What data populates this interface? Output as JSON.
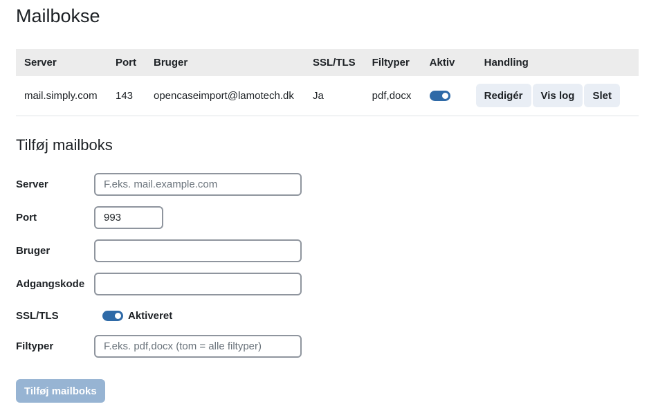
{
  "page": {
    "title": "Mailbokse"
  },
  "table": {
    "headers": [
      "Server",
      "Port",
      "Bruger",
      "SSL/TLS",
      "Filtyper",
      "Aktiv",
      "Handling"
    ],
    "rows": [
      {
        "server": "mail.simply.com",
        "port": "143",
        "user": "opencaseimport@lamotech.dk",
        "ssl": "Ja",
        "filetypes": "pdf,docx",
        "active": true,
        "actions": {
          "edit": "Redigér",
          "log": "Vis log",
          "delete": "Slet"
        }
      }
    ]
  },
  "form": {
    "title": "Tilføj mailboks",
    "server": {
      "label": "Server",
      "placeholder": "F.eks. mail.example.com",
      "value": ""
    },
    "port": {
      "label": "Port",
      "value": "993"
    },
    "user": {
      "label": "Bruger",
      "value": ""
    },
    "password": {
      "label": "Adgangskode",
      "value": ""
    },
    "ssl": {
      "label": "SSL/TLS",
      "status": "Aktiveret",
      "enabled": true
    },
    "filetypes": {
      "label": "Filtyper",
      "placeholder": "F.eks. pdf,docx (tom = alle filtyper)",
      "value": ""
    },
    "submit_label": "Tilføj mailboks"
  },
  "colors": {
    "accent": "#2f6aa7",
    "button_bg": "#e9eef5",
    "submit_disabled": "#97b4d3",
    "header_bg": "#ececec"
  },
  "icons": {
    "toggle": "toggle-switch-icon"
  }
}
